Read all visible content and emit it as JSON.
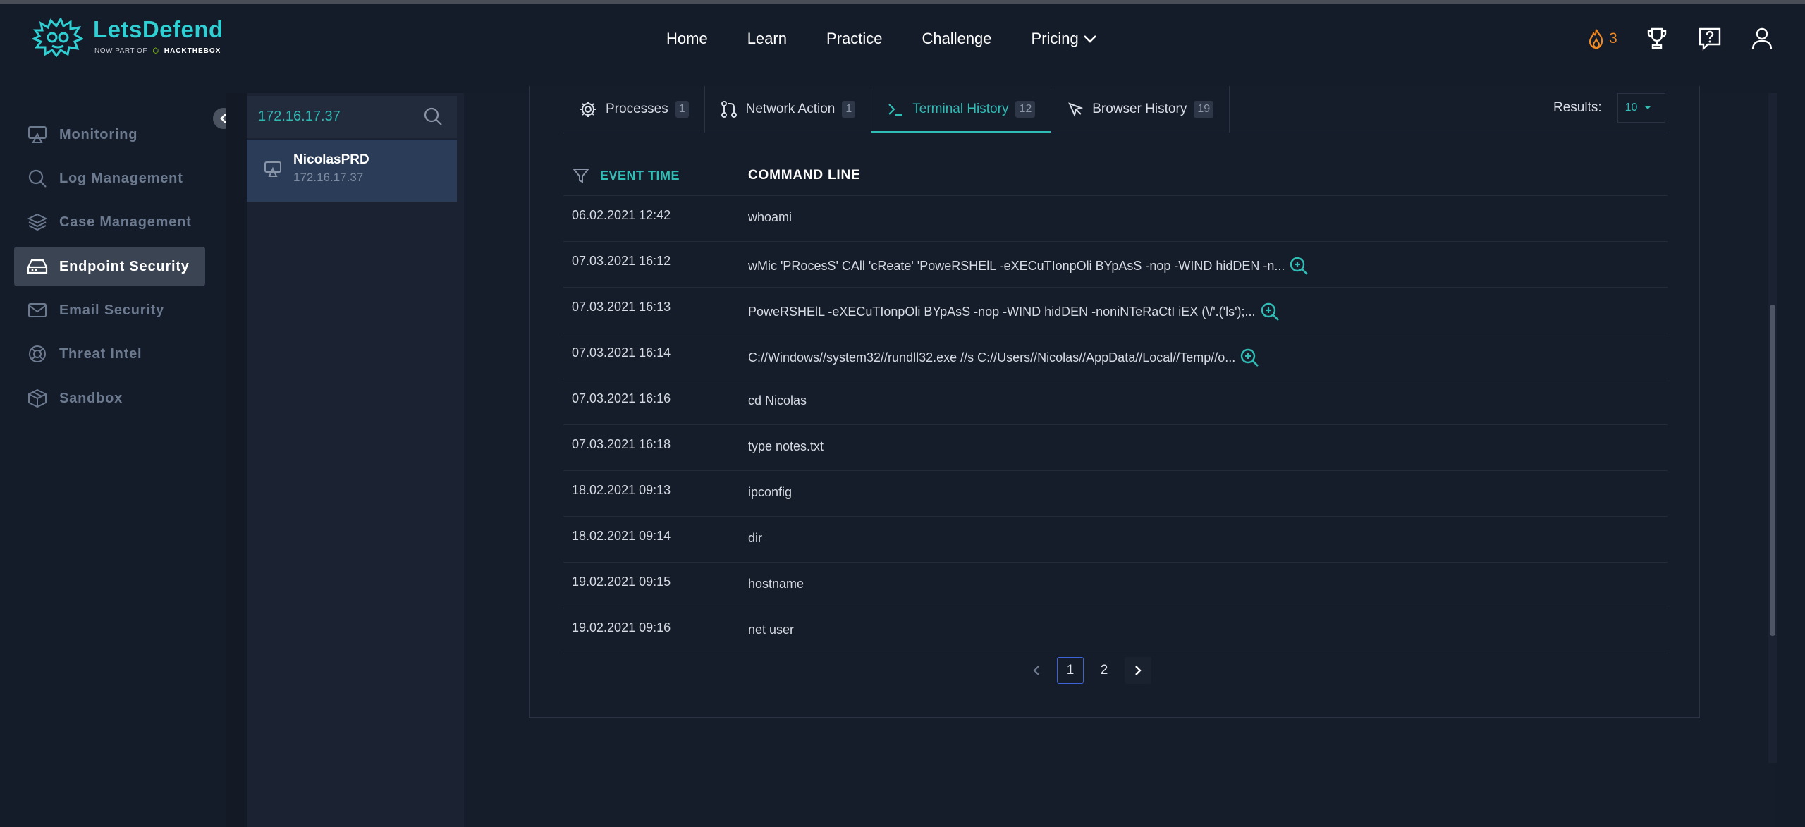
{
  "brand": {
    "name": "LetsDefend",
    "tagline_prefix": "NOW PART OF",
    "tagline_brand": "HACKTHEBOX"
  },
  "nav": [
    {
      "label": "Home"
    },
    {
      "label": "Learn"
    },
    {
      "label": "Practice"
    },
    {
      "label": "Challenge"
    },
    {
      "label": "Pricing"
    }
  ],
  "header": {
    "streak": "3"
  },
  "sidebar": {
    "items": [
      {
        "label": "Monitoring",
        "icon": "monitor-icon"
      },
      {
        "label": "Log Management",
        "icon": "search-icon"
      },
      {
        "label": "Case Management",
        "icon": "layers-icon"
      },
      {
        "label": "Endpoint Security",
        "icon": "hard-drive-icon",
        "active": true
      },
      {
        "label": "Email Security",
        "icon": "mail-icon"
      },
      {
        "label": "Threat Intel",
        "icon": "lifebuoy-icon"
      },
      {
        "label": "Sandbox",
        "icon": "box-icon"
      }
    ]
  },
  "hosts": {
    "search_value": "172.16.17.37",
    "items": [
      {
        "name": "NicolasPRD",
        "ip": "172.16.17.37"
      }
    ]
  },
  "tabs": [
    {
      "label": "Processes",
      "count": "1",
      "icon": "gear-icon"
    },
    {
      "label": "Network Action",
      "count": "1",
      "icon": "git-pull-icon"
    },
    {
      "label": "Terminal History",
      "count": "12",
      "icon": "terminal-icon",
      "active": true
    },
    {
      "label": "Browser History",
      "count": "19",
      "icon": "cursor-icon"
    }
  ],
  "results": {
    "label": "Results:",
    "value": "10"
  },
  "table": {
    "columns": {
      "time": "EVENT TIME",
      "command": "COMMAND LINE"
    },
    "rows": [
      {
        "time": "06.02.2021 12:42",
        "command": "whoami",
        "expand": false
      },
      {
        "time": "07.03.2021 16:12",
        "command": "wMic 'PRocesS' CAll 'cReate' 'PoweRSHElL -eXECuTIonpOli BYpAsS -nop -WIND hidDEN -n...",
        "expand": true
      },
      {
        "time": "07.03.2021 16:13",
        "command": "PoweRSHElL -eXECuTIonpOli BYpAsS -nop -WIND hidDEN -noniNTeRaCtI iEX (\\/'.('ls');...",
        "expand": true
      },
      {
        "time": "07.03.2021 16:14",
        "command": "C://Windows//system32//rundll32.exe //s C://Users//Nicolas//AppData//Local//Temp//o...",
        "expand": true
      },
      {
        "time": "07.03.2021 16:16",
        "command": "cd Nicolas",
        "expand": false
      },
      {
        "time": "07.03.2021 16:18",
        "command": "type notes.txt",
        "expand": false
      },
      {
        "time": "18.02.2021 09:13",
        "command": "ipconfig",
        "expand": false
      },
      {
        "time": "18.02.2021 09:14",
        "command": "dir",
        "expand": false
      },
      {
        "time": "19.02.2021 09:15",
        "command": "hostname",
        "expand": false
      },
      {
        "time": "19.02.2021 09:16",
        "command": "net user",
        "expand": false
      }
    ]
  },
  "pagination": {
    "pages": [
      "1",
      "2"
    ],
    "current": "1"
  },
  "colors": {
    "accent": "#2fbdb5",
    "brand": "#2fd0d3",
    "streak": "#f08a24",
    "active_page": "#3d63d8"
  }
}
